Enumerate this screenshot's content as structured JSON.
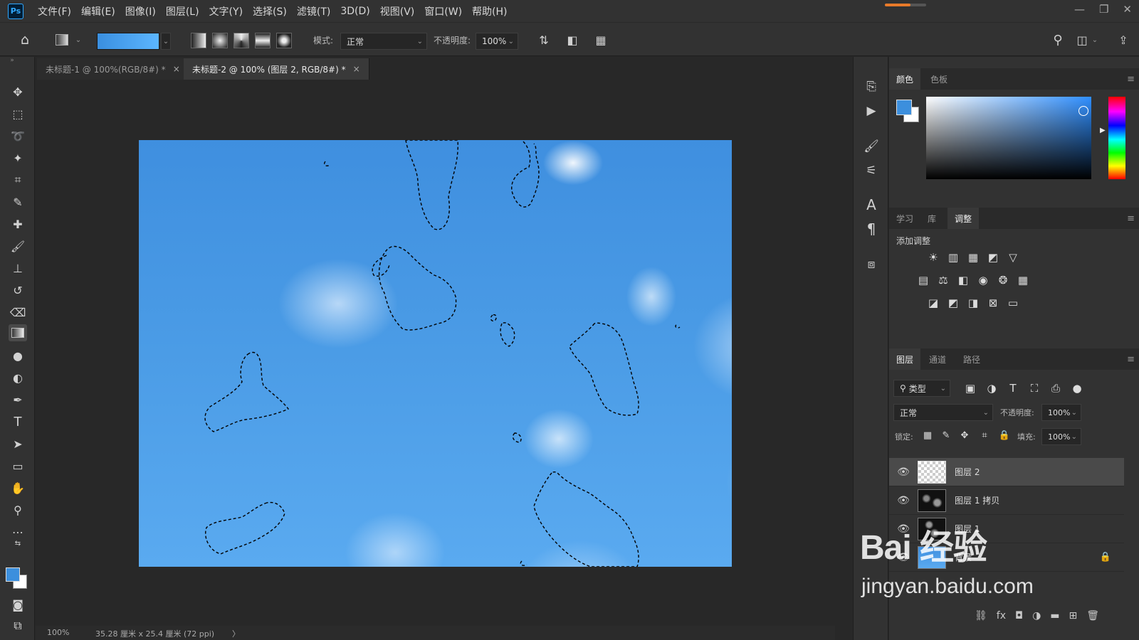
{
  "menubar": {
    "logo": "Ps",
    "items": [
      "文件(F)",
      "编辑(E)",
      "图像(I)",
      "图层(L)",
      "文字(Y)",
      "选择(S)",
      "滤镜(T)",
      "3D(D)",
      "视图(V)",
      "窗口(W)",
      "帮助(H)"
    ],
    "window_controls": [
      "—",
      "❐",
      "✕"
    ]
  },
  "options": {
    "mode_label": "模式:",
    "mode_value": "正常",
    "opacity_label": "不透明度:",
    "opacity_value": "100%"
  },
  "tabs": [
    {
      "label": "未标题-1 @ 100%(RGB/8#) *",
      "close": "×"
    },
    {
      "label": "未标题-2 @ 100% (图层 2, RGB/8#) *",
      "close": "×"
    }
  ],
  "status": {
    "zoom": "100%",
    "doc_info": "35.28 厘米 x 25.4 厘米 (72 ppi)",
    "arrow": "〉"
  },
  "color_panel": {
    "tabs": [
      "颜色",
      "色板"
    ],
    "foreground": "#3c8fdd",
    "background": "#ffffff"
  },
  "adjust_panel": {
    "tabs": [
      "学习",
      "库",
      "调整"
    ],
    "title": "添加调整"
  },
  "layers_panel": {
    "tabs": [
      "图层",
      "通道",
      "路径"
    ],
    "filter_label": "类型",
    "blend_mode": "正常",
    "opacity_label": "不透明度:",
    "opacity_value": "100%",
    "lock_label": "锁定:",
    "fill_label": "填充:",
    "fill_value": "100%",
    "layers": [
      {
        "name": "图层 2",
        "selected": true
      },
      {
        "name": "图层 1 拷贝",
        "selected": false
      },
      {
        "name": "图层 1",
        "selected": false
      },
      {
        "name": "背景",
        "selected": false,
        "locked": true
      }
    ]
  },
  "watermark": {
    "brand": "Bai 经验",
    "url": "jingyan.baidu.com"
  }
}
